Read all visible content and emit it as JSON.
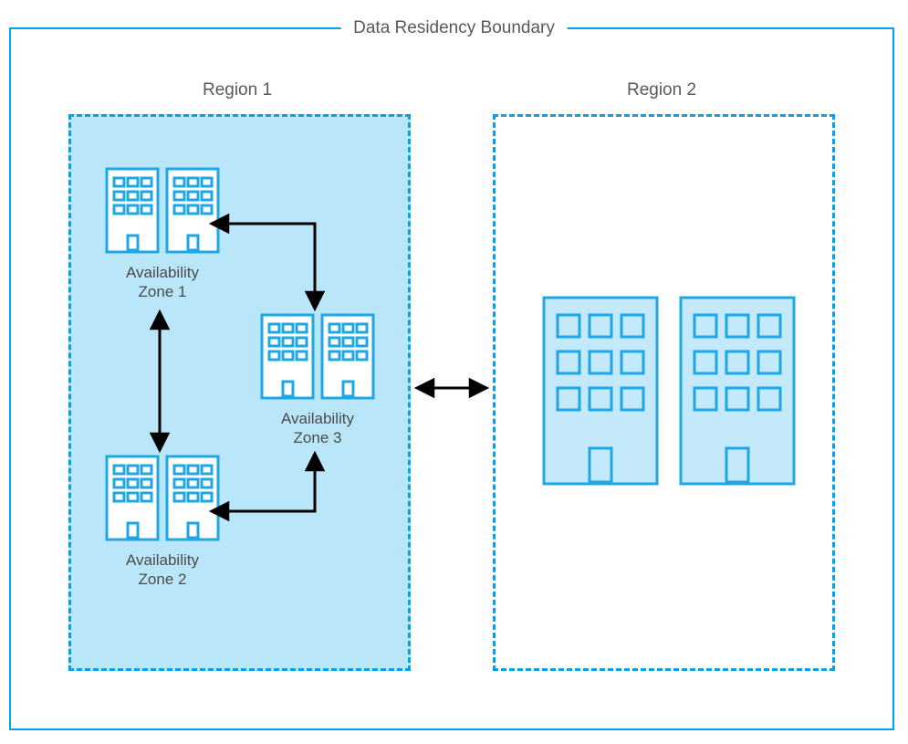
{
  "boundary_label": "Data Residency Boundary",
  "region1": {
    "title": "Region 1",
    "az1": {
      "label_line1": "Availability",
      "label_line2": "Zone 1"
    },
    "az2": {
      "label_line1": "Availability",
      "label_line2": "Zone 2"
    },
    "az3": {
      "label_line1": "Availability",
      "label_line2": "Zone 3"
    }
  },
  "region2": {
    "title": "Region 2"
  },
  "colors": {
    "accent": "#00a2ed",
    "fill_light": "#bae6f9",
    "bld_fill": "#c4e9fa",
    "bld_stroke": "#1ea7e4",
    "arrow": "#000000",
    "text": "#4b4b4b"
  }
}
